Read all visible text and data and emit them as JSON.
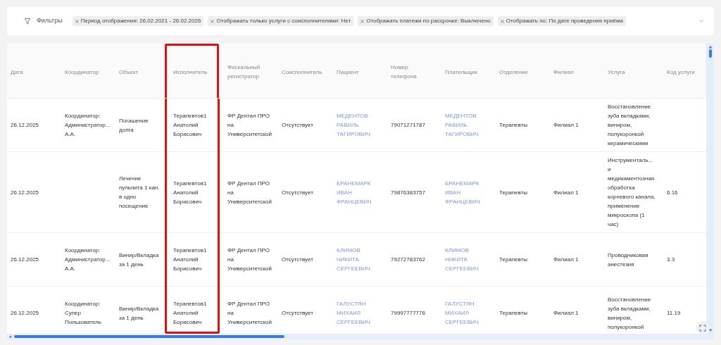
{
  "filters": {
    "title": "Фильтры",
    "chips": [
      {
        "label": "Период отображения: 26.02.2021 - 26.02.2026"
      },
      {
        "label": "Отображать только услуги с соисполнителями: Нет"
      },
      {
        "label": "Отображать платежи по рассрочке: Выключено"
      },
      {
        "label": "Отображать по: По дате проведения приёма"
      }
    ]
  },
  "table": {
    "columns": [
      {
        "label": "Дата",
        "kind": "text",
        "highlighted": false
      },
      {
        "label": "Координатор",
        "kind": "text",
        "highlighted": false
      },
      {
        "label": "Объект",
        "kind": "text",
        "highlighted": false
      },
      {
        "label": "Исполнитель",
        "kind": "text",
        "highlighted": true
      },
      {
        "label": "Фискальный регистратор",
        "kind": "text",
        "highlighted": false
      },
      {
        "label": "Соисполнитель",
        "kind": "text",
        "highlighted": false
      },
      {
        "label": "Пациент",
        "kind": "link",
        "highlighted": false
      },
      {
        "label": "Номер телефона",
        "kind": "text",
        "highlighted": false
      },
      {
        "label": "Плательщик",
        "kind": "link",
        "highlighted": false
      },
      {
        "label": "Отделение",
        "kind": "text",
        "highlighted": false
      },
      {
        "label": "Филиал",
        "kind": "text",
        "highlighted": false
      },
      {
        "label": "Услуга",
        "kind": "text",
        "highlighted": false
      },
      {
        "label": "Код услуги",
        "kind": "text",
        "highlighted": false
      }
    ],
    "rows": [
      {
        "cells": [
          "26.12.2025",
          "Координатор: Администратор... А.А.",
          "Погашение долга",
          "Терапевтов1 Анатолий Борисович",
          "ФР Дентал ПРО на Университетской",
          "Отсутствует",
          "МЕДЕНТОВ РАВИЛЬ ТАГИРОВИЧ",
          "79071271787",
          "МЕДЕНТОВ РАВИЛЬ ТАГИРОВИЧ",
          "Терапевты",
          "Филиал 1",
          "Восстановление зуба вкладками, виниром, полукоронкой керамическими",
          ""
        ]
      },
      {
        "cells": [
          "26.12.2025",
          "",
          "Лечение пульпита 1 кан. в одно посещение",
          "Терапевтов1 Анатолий Борисович",
          "ФР Дентал ПРО на Университетской",
          "Отсутствует",
          "БРАНЕМАРК ИВАН ФРАНЦЕВИЧ",
          "79876383757",
          "БРАНЕМАРК ИВАН ФРАНЦЕВИЧ",
          "Терапевты",
          "Филиал 1",
          "Инструменталь... и медикаментозная обработка корневого канала, применение микроскопа (1 час)",
          "6.16"
        ]
      },
      {
        "cells": [
          "26.12.2025",
          "Координатор: Администратор... А.А.",
          "Винир/Вкладка за 1 день",
          "Терапевтов1 Анатолий Борисович",
          "ФР Дентал ПРО на Университетской",
          "Отсутствует",
          "КЛИМОВ НИКИТА СЕРГЕЕВИЧ",
          "79272783762",
          "КЛИМОВ НИКИТА СЕРГЕЕВИЧ",
          "Терапевты",
          "Филиал 1",
          "Проводниковая анестезия",
          "3.3"
        ]
      },
      {
        "cells": [
          "26.12.2025",
          "Координатор: Супер Пользователь",
          "Винир/Вкладка за 1 день",
          "Терапевтов1 Анатолий Борисович",
          "ФР Дентал ПРО на Университетской",
          "Отсутствует",
          "ГАЛУСТЯН МИХАИЛ СЕРГЕЕВИЧ",
          "79997777776",
          "ГАЛУСТЯН МИХАИЛ СЕРГЕЕВИЧ",
          "Терапевты",
          "Филиал 1",
          "Восстановление зуба вкладками, виниром, полукоронкой",
          "11.19"
        ]
      }
    ]
  }
}
